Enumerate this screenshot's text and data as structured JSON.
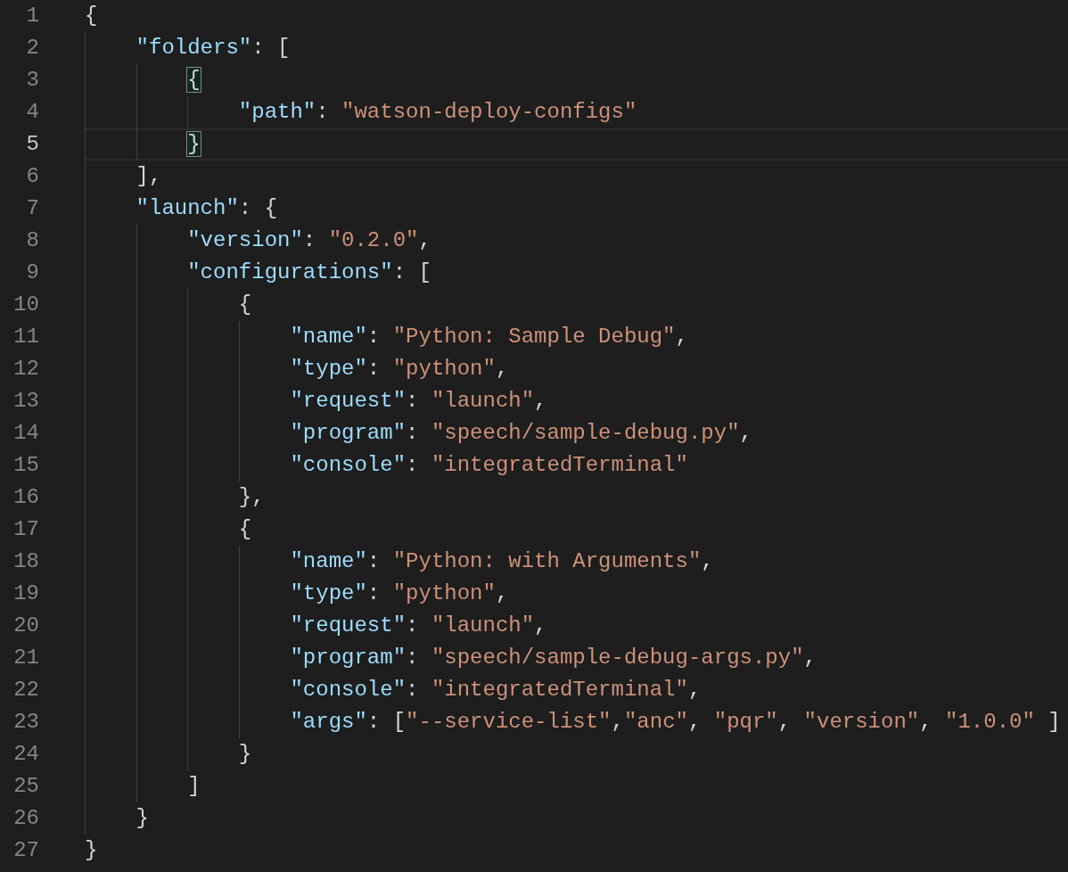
{
  "editor": {
    "lines": [
      {
        "number": "1",
        "current": false,
        "tokens": [
          {
            "kind": "punct",
            "text": "{"
          }
        ]
      },
      {
        "number": "2",
        "current": false,
        "tokens": [
          {
            "kind": "key",
            "text": "    \"folders\""
          },
          {
            "kind": "punct",
            "text": ": ["
          }
        ]
      },
      {
        "number": "3",
        "current": false,
        "tokens": [
          {
            "kind": "match",
            "text": "        {"
          }
        ]
      },
      {
        "number": "4",
        "current": false,
        "tokens": [
          {
            "kind": "key",
            "text": "            \"path\""
          },
          {
            "kind": "punct",
            "text": ": "
          },
          {
            "kind": "string",
            "text": "\"watson-deploy-configs\""
          }
        ]
      },
      {
        "number": "5",
        "current": true,
        "tokens": [
          {
            "kind": "match",
            "text": "        }"
          }
        ]
      },
      {
        "number": "6",
        "current": false,
        "tokens": [
          {
            "kind": "punct",
            "text": "    ],"
          }
        ]
      },
      {
        "number": "7",
        "current": false,
        "tokens": [
          {
            "kind": "key",
            "text": "    \"launch\""
          },
          {
            "kind": "punct",
            "text": ": {"
          }
        ]
      },
      {
        "number": "8",
        "current": false,
        "tokens": [
          {
            "kind": "key",
            "text": "        \"version\""
          },
          {
            "kind": "punct",
            "text": ": "
          },
          {
            "kind": "string",
            "text": "\"0.2.0\""
          },
          {
            "kind": "punct",
            "text": ","
          }
        ]
      },
      {
        "number": "9",
        "current": false,
        "tokens": [
          {
            "kind": "key",
            "text": "        \"configurations\""
          },
          {
            "kind": "punct",
            "text": ": ["
          }
        ]
      },
      {
        "number": "10",
        "current": false,
        "tokens": [
          {
            "kind": "punct",
            "text": "            {"
          }
        ]
      },
      {
        "number": "11",
        "current": false,
        "tokens": [
          {
            "kind": "key",
            "text": "                \"name\""
          },
          {
            "kind": "punct",
            "text": ": "
          },
          {
            "kind": "string",
            "text": "\"Python: Sample Debug\""
          },
          {
            "kind": "punct",
            "text": ","
          }
        ]
      },
      {
        "number": "12",
        "current": false,
        "tokens": [
          {
            "kind": "key",
            "text": "                \"type\""
          },
          {
            "kind": "punct",
            "text": ": "
          },
          {
            "kind": "string",
            "text": "\"python\""
          },
          {
            "kind": "punct",
            "text": ","
          }
        ]
      },
      {
        "number": "13",
        "current": false,
        "tokens": [
          {
            "kind": "key",
            "text": "                \"request\""
          },
          {
            "kind": "punct",
            "text": ": "
          },
          {
            "kind": "string",
            "text": "\"launch\""
          },
          {
            "kind": "punct",
            "text": ","
          }
        ]
      },
      {
        "number": "14",
        "current": false,
        "tokens": [
          {
            "kind": "key",
            "text": "                \"program\""
          },
          {
            "kind": "punct",
            "text": ": "
          },
          {
            "kind": "string",
            "text": "\"speech/sample-debug.py\""
          },
          {
            "kind": "punct",
            "text": ","
          }
        ]
      },
      {
        "number": "15",
        "current": false,
        "tokens": [
          {
            "kind": "key",
            "text": "                \"console\""
          },
          {
            "kind": "punct",
            "text": ": "
          },
          {
            "kind": "string",
            "text": "\"integratedTerminal\""
          }
        ]
      },
      {
        "number": "16",
        "current": false,
        "tokens": [
          {
            "kind": "punct",
            "text": "            },"
          }
        ]
      },
      {
        "number": "17",
        "current": false,
        "tokens": [
          {
            "kind": "punct",
            "text": "            {"
          }
        ]
      },
      {
        "number": "18",
        "current": false,
        "tokens": [
          {
            "kind": "key",
            "text": "                \"name\""
          },
          {
            "kind": "punct",
            "text": ": "
          },
          {
            "kind": "string",
            "text": "\"Python: with Arguments\""
          },
          {
            "kind": "punct",
            "text": ","
          }
        ]
      },
      {
        "number": "19",
        "current": false,
        "tokens": [
          {
            "kind": "key",
            "text": "                \"type\""
          },
          {
            "kind": "punct",
            "text": ": "
          },
          {
            "kind": "string",
            "text": "\"python\""
          },
          {
            "kind": "punct",
            "text": ","
          }
        ]
      },
      {
        "number": "20",
        "current": false,
        "tokens": [
          {
            "kind": "key",
            "text": "                \"request\""
          },
          {
            "kind": "punct",
            "text": ": "
          },
          {
            "kind": "string",
            "text": "\"launch\""
          },
          {
            "kind": "punct",
            "text": ","
          }
        ]
      },
      {
        "number": "21",
        "current": false,
        "tokens": [
          {
            "kind": "key",
            "text": "                \"program\""
          },
          {
            "kind": "punct",
            "text": ": "
          },
          {
            "kind": "string",
            "text": "\"speech/sample-debug-args.py\""
          },
          {
            "kind": "punct",
            "text": ","
          }
        ]
      },
      {
        "number": "22",
        "current": false,
        "tokens": [
          {
            "kind": "key",
            "text": "                \"console\""
          },
          {
            "kind": "punct",
            "text": ": "
          },
          {
            "kind": "string",
            "text": "\"integratedTerminal\""
          },
          {
            "kind": "punct",
            "text": ","
          }
        ]
      },
      {
        "number": "23",
        "current": false,
        "tokens": [
          {
            "kind": "key",
            "text": "                \"args\""
          },
          {
            "kind": "punct",
            "text": ": ["
          },
          {
            "kind": "string",
            "text": "\"--service-list\""
          },
          {
            "kind": "punct",
            "text": ","
          },
          {
            "kind": "string",
            "text": "\"anc\""
          },
          {
            "kind": "punct",
            "text": ", "
          },
          {
            "kind": "string",
            "text": "\"pqr\""
          },
          {
            "kind": "punct",
            "text": ", "
          },
          {
            "kind": "string",
            "text": "\"version\""
          },
          {
            "kind": "punct",
            "text": ", "
          },
          {
            "kind": "string",
            "text": "\"1.0.0\""
          },
          {
            "kind": "punct",
            "text": " ]"
          }
        ]
      },
      {
        "number": "24",
        "current": false,
        "tokens": [
          {
            "kind": "punct",
            "text": "            }"
          }
        ]
      },
      {
        "number": "25",
        "current": false,
        "tokens": [
          {
            "kind": "punct",
            "text": "        ]"
          }
        ]
      },
      {
        "number": "26",
        "current": false,
        "tokens": [
          {
            "kind": "punct",
            "text": "    }"
          }
        ]
      },
      {
        "number": "27",
        "current": false,
        "tokens": [
          {
            "kind": "punct",
            "text": "}"
          }
        ]
      }
    ]
  }
}
